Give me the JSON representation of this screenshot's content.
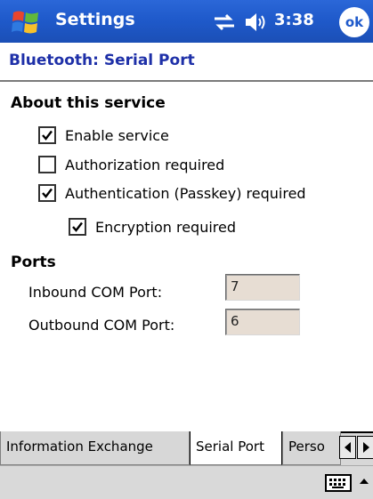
{
  "titlebar": {
    "title": "Settings",
    "time": "3:38",
    "ok_label": "ok"
  },
  "header": {
    "title": "Bluetooth: Serial Port"
  },
  "about": {
    "heading": "About this service",
    "options": [
      {
        "label": "Enable service",
        "checked": true
      },
      {
        "label": "Authorization required",
        "checked": false
      },
      {
        "label": "Authentication (Passkey) required",
        "checked": true
      },
      {
        "label": "Encryption required",
        "checked": true
      }
    ]
  },
  "ports": {
    "heading": "Ports",
    "inbound_label": "Inbound COM Port:",
    "inbound_value": "7",
    "outbound_label": "Outbound COM Port:",
    "outbound_value": "6"
  },
  "tabs": [
    {
      "label": "Information Exchange"
    },
    {
      "label": "Serial Port"
    },
    {
      "label": "Perso"
    }
  ],
  "colors": {
    "titlebar": "#1f5acb",
    "header_text": "#1e30a8",
    "port_field": "#e7ddd3"
  }
}
